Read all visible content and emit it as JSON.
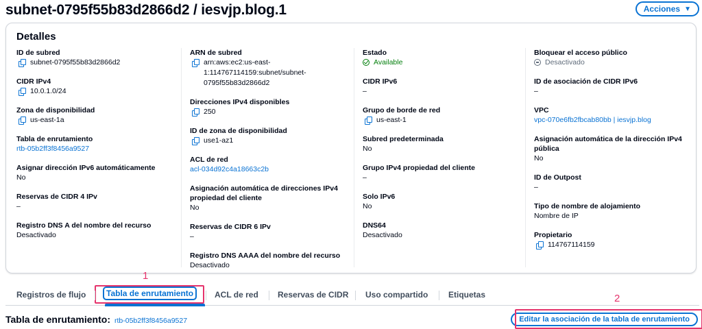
{
  "header": {
    "title": "subnet-0795f55b83d2866d2 / iesvjp.blog.1",
    "actions_label": "Acciones"
  },
  "details": {
    "title": "Detalles",
    "columns": [
      [
        {
          "label": "ID de subred",
          "value": "subnet-0795f55b83d2866d2",
          "kind": "copy"
        },
        {
          "label": "CIDR IPv4",
          "value": "10.0.1.0/24",
          "kind": "copy"
        },
        {
          "label": "Zona de disponibilidad",
          "value": "us-east-1a",
          "kind": "copy"
        },
        {
          "label": "Tabla de enrutamiento",
          "value": "rtb-05b2ff3f8456a9527",
          "kind": "link"
        },
        {
          "label": "Asignar dirección IPv6 automáticamente",
          "value": "No",
          "kind": "text"
        },
        {
          "label": "Reservas de CIDR 4 IPv",
          "value": "–",
          "kind": "text"
        },
        {
          "label": "Registro DNS A del nombre del recurso",
          "value": "Desactivado",
          "kind": "text"
        }
      ],
      [
        {
          "label": "ARN de subred",
          "value": "arn:aws:ec2:us-east-1:114767114159:subnet/subnet-0795f55b83d2866d2",
          "kind": "copy"
        },
        {
          "label": "Direcciones IPv4 disponibles",
          "value": "250",
          "kind": "copy"
        },
        {
          "label": "ID de zona de disponibilidad",
          "value": "use1-az1",
          "kind": "copy"
        },
        {
          "label": "ACL de red",
          "value": "acl-034d92c4a18663c2b",
          "kind": "link"
        },
        {
          "label": "Asignación automática de direcciones IPv4 propiedad del cliente",
          "value": "No",
          "kind": "text"
        },
        {
          "label": "Reservas de CIDR 6 IPv",
          "value": "–",
          "kind": "text"
        },
        {
          "label": "Registro DNS AAAA del nombre del recurso",
          "value": "Desactivado",
          "kind": "text"
        }
      ],
      [
        {
          "label": "Estado",
          "value": "Available",
          "kind": "ok"
        },
        {
          "label": "CIDR IPv6",
          "value": "–",
          "kind": "text"
        },
        {
          "label": "Grupo de borde de red",
          "value": "us-east-1",
          "kind": "copy"
        },
        {
          "label": "Subred predeterminada",
          "value": "No",
          "kind": "text"
        },
        {
          "label": "Grupo IPv4 propiedad del cliente",
          "value": "–",
          "kind": "text"
        },
        {
          "label": "Solo IPv6",
          "value": "No",
          "kind": "text"
        },
        {
          "label": "DNS64",
          "value": "Desactivado",
          "kind": "text"
        }
      ],
      [
        {
          "label": "Bloquear el acceso público",
          "value": "Desactivado",
          "kind": "off"
        },
        {
          "label": "ID de asociación de CIDR IPv6",
          "value": "–",
          "kind": "text"
        },
        {
          "label": "VPC",
          "value": "vpc-070e6fb2fbcab80bb | iesvjp.blog",
          "kind": "link"
        },
        {
          "label": "Asignación automática de la dirección IPv4 pública",
          "value": "No",
          "kind": "text"
        },
        {
          "label": "ID de Outpost",
          "value": "–",
          "kind": "text"
        },
        {
          "label": "Tipo de nombre de alojamiento",
          "value": "Nombre de IP",
          "kind": "text"
        },
        {
          "label": "Propietario",
          "value": "114767114159",
          "kind": "copy"
        }
      ]
    ]
  },
  "annotations": {
    "one": "1",
    "two": "2",
    "color": "#e5326b"
  },
  "tabs": {
    "flow_logs": "Registros de flujo",
    "route_table": "Tabla de enrutamiento",
    "network_acl": "ACL de red",
    "cidr_reservations": "Reservas de CIDR",
    "sharing": "Uso compartido",
    "tags": "Etiquetas",
    "active": "route_table"
  },
  "route_table": {
    "title": "Tabla de enrutamiento:",
    "id": "rtb-05b2ff3f8456a9527",
    "edit_label": "Editar la asociación de la tabla de enrutamiento"
  },
  "colors": {
    "accent": "#0972d3",
    "success": "#037f0c",
    "muted": "#5f6b7a",
    "text": "#000716"
  }
}
